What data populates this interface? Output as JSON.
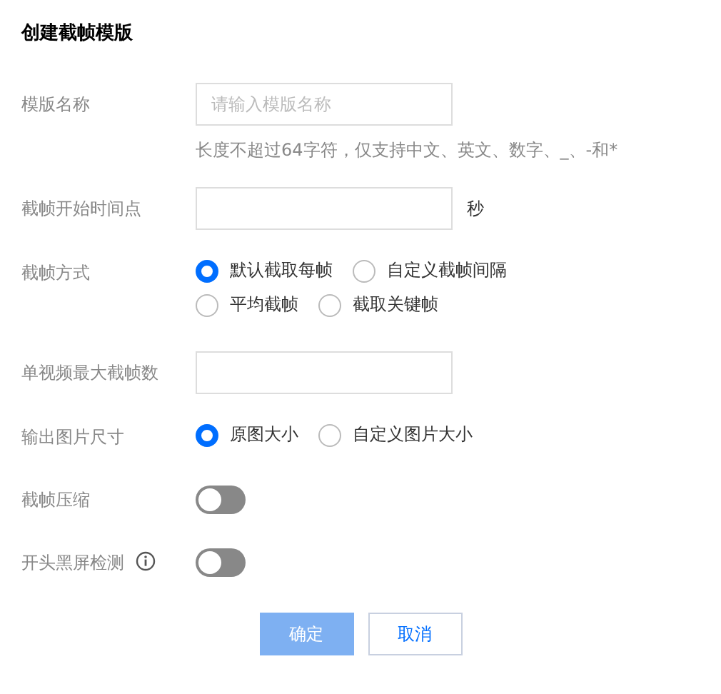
{
  "title": "创建截帧模版",
  "fields": [
    {
      "kind": "input",
      "label": "模版名称",
      "placeholder": "请输入模版名称",
      "hint": "长度不超过64字符，仅支持中文、英文、数字、_、-和*"
    },
    {
      "kind": "input",
      "label": "截帧开始时间点",
      "unit": "秒"
    },
    {
      "kind": "radio",
      "label": "截帧方式",
      "options": [
        {
          "label": "默认截取每帧",
          "selected": true
        },
        {
          "label": "自定义截帧间隔",
          "selected": false
        },
        {
          "label": "平均截帧",
          "selected": false
        },
        {
          "label": "截取关键帧",
          "selected": false
        }
      ]
    },
    {
      "kind": "input",
      "label": "单视频最大截帧数"
    },
    {
      "kind": "radio",
      "label": "输出图片尺寸",
      "options": [
        {
          "label": "原图大小",
          "selected": true
        },
        {
          "label": "自定义图片大小",
          "selected": false
        }
      ]
    },
    {
      "kind": "toggle",
      "label": "截帧压缩",
      "on": false
    },
    {
      "kind": "toggle",
      "label": "开头黑屏检测",
      "info": true,
      "on": false
    }
  ],
  "buttons": [
    {
      "kind": "primary",
      "label": "确定",
      "disabled": true
    },
    {
      "kind": "default",
      "label": "取消",
      "disabled": false
    }
  ]
}
